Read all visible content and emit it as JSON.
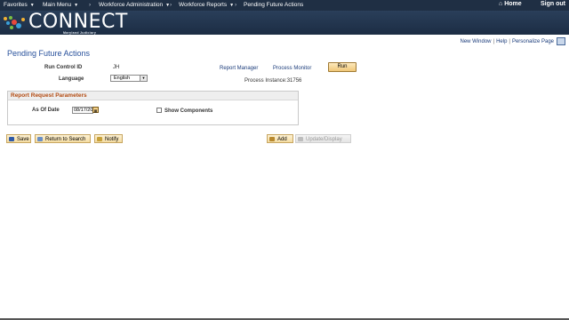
{
  "topnav": {
    "favorites": "Favorites",
    "main_menu": "Main Menu",
    "breadcrumb_1": "Workforce Administration",
    "breadcrumb_2": "Workforce Reports",
    "breadcrumb_3": "Pending Future Actions",
    "home": "Home",
    "signout": "Sign out"
  },
  "banner": {
    "logo": "CONNECT",
    "subtitle": "Maryland Judiciary"
  },
  "pagelinks": {
    "new_window": "New Window",
    "help": "Help",
    "personalize": "Personalize Page"
  },
  "page": {
    "title": "Pending Future Actions"
  },
  "form": {
    "run_control_label": "Run Control ID",
    "run_control_value": "JH",
    "language_label": "Language",
    "language_value": "English",
    "report_manager": "Report Manager",
    "process_monitor": "Process Monitor",
    "run_button": "Run",
    "process_instance": "Process Instance:31756"
  },
  "params": {
    "header": "Report Request Parameters",
    "as_of_label": "As Of Date",
    "as_of_value": "08/17/2015",
    "show_components": "Show Components"
  },
  "toolbar": {
    "save": "Save",
    "return_to_search": "Return to Search",
    "notify": "Notify",
    "add": "Add",
    "update_display": "Update/Display"
  },
  "colors": {
    "nav_bg": "#1f2f44",
    "title_blue": "#27509b",
    "section_header": "#b34a10",
    "button_gold": "#f4dca2"
  }
}
